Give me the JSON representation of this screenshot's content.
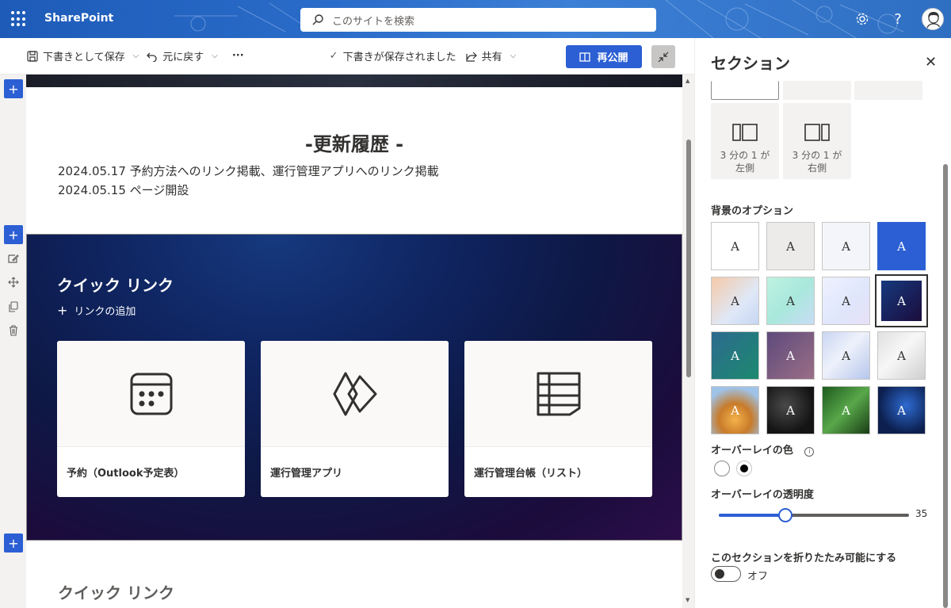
{
  "suite": {
    "brand": "SharePoint",
    "search_placeholder": "このサイトを検索"
  },
  "command_bar": {
    "save_draft": "下書きとして保存",
    "undo": "元に戻す",
    "more": "···",
    "draft_status": "下書きが保存されました",
    "share": "共有",
    "republish": "再公開"
  },
  "canvas": {
    "history_title": "-更新履歴 -",
    "history_lines": [
      "2024.05.17 予約方法へのリンク掲載、運行管理アプリへのリンク掲載",
      "2024.05.15 ページ開設"
    ],
    "quick_links": {
      "title": "クイック リンク",
      "add_link": "リンクの追加",
      "cards": [
        {
          "label": "予約（Outlook予定表）",
          "icon": "calendar-icon"
        },
        {
          "label": "運行管理アプリ",
          "icon": "power-apps-icon"
        },
        {
          "label": "運行管理台帳（リスト）",
          "icon": "list-icon"
        }
      ]
    },
    "quick_links_2_title": "クイック リンク"
  },
  "panel": {
    "title": "セクション",
    "layouts": [
      {
        "label": "3 分の 1 が左側"
      },
      {
        "label": "3 分の 1 が右側"
      }
    ],
    "layouts_display": [
      {
        "line1": "3 分の 1 が",
        "line2": "左側"
      },
      {
        "line1": "3 分の 1 が",
        "line2": "右側"
      }
    ],
    "background_label": "背景のオプション",
    "tile_glyph": "A",
    "overlay_color_label": "オーバーレイの色",
    "overlay_opacity_label": "オーバーレイの透明度",
    "overlay_opacity_value": 35,
    "overlay_opacity_text": "35",
    "collapsible_label": "このセクションを折りたたみ可能にする",
    "toggle_state": "オフ"
  },
  "colors": {
    "accent": "#2c5fd4"
  }
}
